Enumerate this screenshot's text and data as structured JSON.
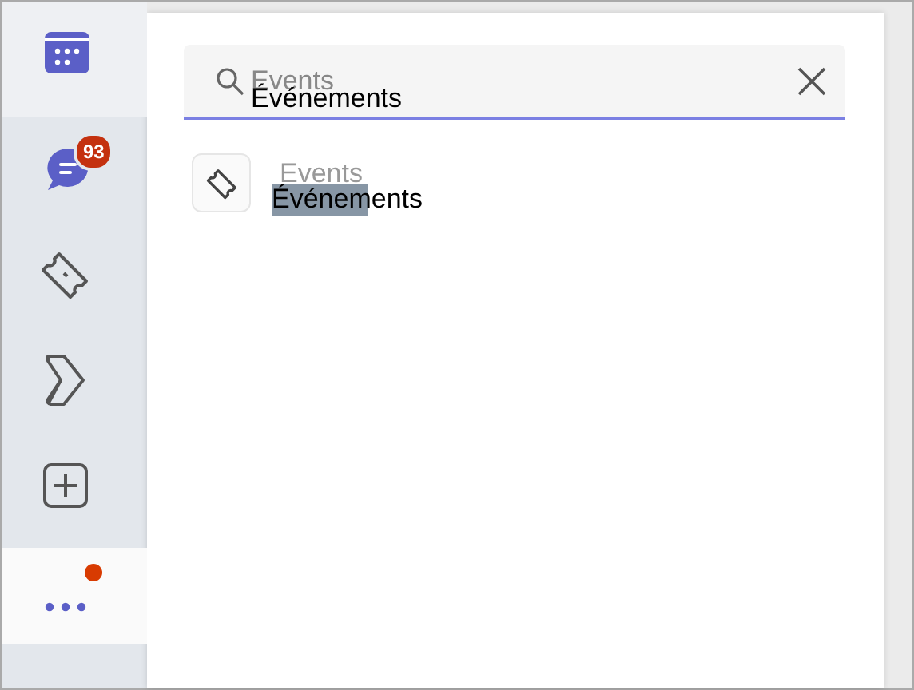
{
  "rail": {
    "items": [
      {
        "kind": "calendar",
        "selected": true
      },
      {
        "kind": "chat",
        "selected": false,
        "badge": "93"
      },
      {
        "kind": "ticket",
        "selected": false
      },
      {
        "kind": "chevron",
        "selected": false
      },
      {
        "kind": "add",
        "selected": false
      },
      {
        "kind": "more",
        "selected": true,
        "dot": true
      }
    ]
  },
  "search": {
    "value": "Events",
    "overlay_label": "Événements"
  },
  "results": [
    {
      "label": "Events",
      "overlay_label": "Événements"
    }
  ]
}
